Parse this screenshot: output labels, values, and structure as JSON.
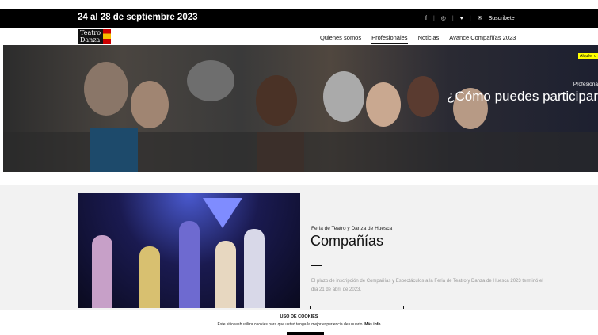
{
  "header": {
    "dates": "24 al 28 de septiembre 2023",
    "social": [
      {
        "icon": "facebook-icon",
        "glyph": "f"
      },
      {
        "icon": "instagram-icon",
        "glyph": "◎"
      },
      {
        "icon": "twitter-icon",
        "glyph": "♥"
      },
      {
        "icon": "mail-icon",
        "glyph": "✉"
      }
    ],
    "subscribe": "Suscribete"
  },
  "logo": {
    "line1": "Teatro",
    "line2": "Danza"
  },
  "nav": {
    "items": [
      "Quienes somos",
      "Profesionales",
      "Noticias",
      "Avance Compañías 2023"
    ],
    "active": "Profesionales"
  },
  "hero": {
    "tag": "Alquiler d",
    "subtitle": "Profesiona",
    "title": "¿Cómo puedes participar"
  },
  "feature": {
    "kicker": "Feria de Teatro y Danza de Huesca",
    "heading": "Compañías",
    "text": "El plazo de inscripción de Compañías y Espectáculos a la Feria de Teatro y Danza de Huesca 2023 terminó el día 21 de abril de 2023."
  },
  "cookies": {
    "title": "USO DE COOKIES",
    "text": "Este sitio web utiliza cookies para que usted tenga la mejor experiencia de usuario.",
    "more": "Más info"
  }
}
